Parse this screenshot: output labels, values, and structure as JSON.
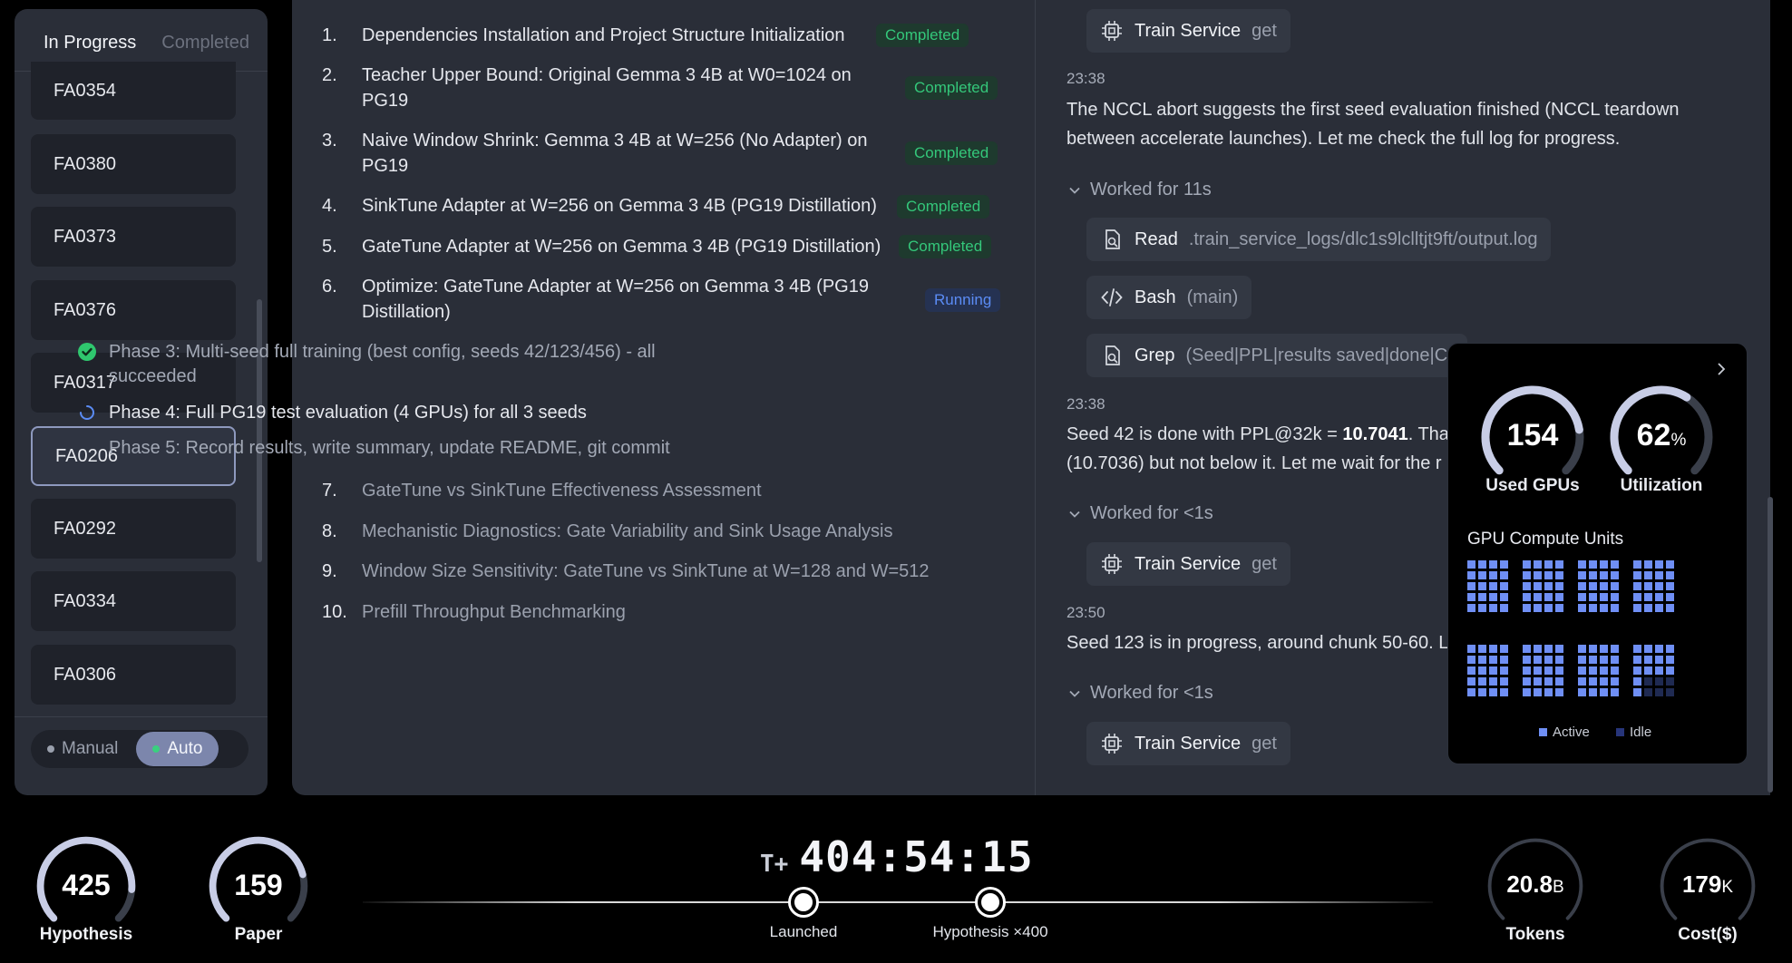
{
  "sidebar": {
    "tabs": [
      {
        "label": "In Progress",
        "active": true
      },
      {
        "label": "Completed",
        "active": false
      }
    ],
    "items": [
      "FA0354",
      "FA0380",
      "FA0373",
      "FA0376",
      "FA0317",
      "FA0206",
      "FA0292",
      "FA0334",
      "FA0306"
    ],
    "selected": "FA0206",
    "modes": {
      "manual": "Manual",
      "auto": "Auto",
      "active": "Auto"
    }
  },
  "tasks": [
    {
      "num": "1.",
      "title": "Dependencies Installation and Project Structure Initialization",
      "status": "Completed"
    },
    {
      "num": "2.",
      "title_l1": "Teacher Upper Bound: Original Gemma 3 4B at W0=1024 on",
      "title_l2": "PG19",
      "status": "Completed"
    },
    {
      "num": "3.",
      "title_l1": "Naive Window Shrink: Gemma 3 4B at W=256 (No Adapter) on",
      "title_l2": "PG19",
      "status": "Completed"
    },
    {
      "num": "4.",
      "title": "SinkTune Adapter at W=256 on Gemma 3 4B (PG19 Distillation)",
      "status": "Completed"
    },
    {
      "num": "5.",
      "title": "GateTune Adapter at W=256 on Gemma 3 4B (PG19 Distillation)",
      "status": "Completed"
    },
    {
      "num": "6.",
      "title_l1": "Optimize: GateTune Adapter at W=256 on Gemma 3 4B (PG19",
      "title_l2": "Distillation)",
      "status": "Running"
    },
    {
      "num": "7.",
      "title": "GateTune vs SinkTune Effectiveness Assessment"
    },
    {
      "num": "8.",
      "title": "Mechanistic Diagnostics: Gate Variability and Sink Usage Analysis"
    },
    {
      "num": "9.",
      "title": "Window Size Sensitivity: GateTune vs SinkTune at W=128 and W=512"
    },
    {
      "num": "10.",
      "title": "Prefill Throughput Benchmarking"
    }
  ],
  "phases": [
    {
      "l1": "Phase 3: Multi-seed full training (best config, seeds 42/123/456) - all",
      "l2": "succeeded",
      "state": "done"
    },
    {
      "l1": "Phase 4: Full PG19 test evaluation (4 GPUs) for all 3 seeds",
      "state": "running"
    },
    {
      "l1": "Phase 5: Record results, write summary, update README, git commit",
      "state": "pending"
    }
  ],
  "log": {
    "tool_top": {
      "name": "Train Service",
      "arg": "get"
    },
    "ts1": "23:38",
    "msg1_l1": "The NCCL abort suggests the first seed evaluation finished (NCCL teardown",
    "msg1_l2": "between accelerate launches). Let me check the full log for progress.",
    "worked1": "Worked for 11s",
    "read": {
      "name": "Read",
      "arg": ".train_service_logs/dlc1s9lclltjt9ft/output.log"
    },
    "bash": {
      "name": "Bash",
      "arg": "(main)"
    },
    "grep": {
      "name": "Grep",
      "arg": "(Seed|PPL|results saved|done|C"
    },
    "ts2": "23:38",
    "msg2_pre": "Seed 42 is done with PPL@32k = ",
    "msg2_bold": "10.7041",
    "msg2_post": ". Tha",
    "msg2_l2": "(10.7036) but not below it. Let me wait for the r",
    "worked2": "Worked for <1s",
    "tool2": {
      "name": "Train Service",
      "arg": "get"
    },
    "ts3": "23:50",
    "msg3": "Seed 123 is in progress, around chunk 50-60. L",
    "worked3": "Worked for <1s",
    "tool3": {
      "name": "Train Service",
      "arg": "get"
    }
  },
  "gpu": {
    "used_gpus": "154",
    "used_label": "Used GPUs",
    "used_fraction": 0.8,
    "utilization": "62",
    "utilization_unit": "%",
    "utilization_label": "Utilization",
    "utilization_fraction": 0.62,
    "units_title": "GPU Compute Units",
    "legend_active": "Active",
    "legend_idle": "Idle",
    "colors": {
      "active": "#6f8ff5",
      "idle": "#1f2a52"
    }
  },
  "bottom": {
    "hypothesis": {
      "value": "425",
      "label": "Hypothesis",
      "fraction": 0.85
    },
    "paper": {
      "value": "159",
      "label": "Paper",
      "fraction": 0.78
    },
    "timer_prefix": "T+",
    "timer": "404:54:15",
    "milestones": [
      "Launched",
      "Hypothesis ×400"
    ],
    "tokens": {
      "value": "20.8",
      "unit": "B",
      "label": "Tokens",
      "fraction": 0.6
    },
    "cost": {
      "value": "179",
      "unit": "K",
      "label": "Cost($)",
      "fraction": 0.6
    }
  }
}
